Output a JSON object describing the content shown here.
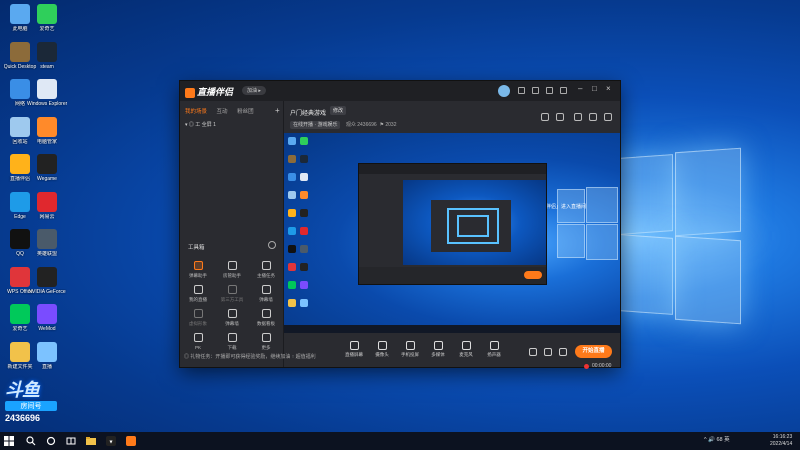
{
  "desktop": {
    "icons": [
      {
        "label": "此电脑",
        "color": "#5aa9f0"
      },
      {
        "label": "爱奇艺",
        "color": "#2fcf5b"
      },
      {
        "label": "Quick Desktop",
        "color": "#8c6b3a"
      },
      {
        "label": "steam",
        "color": "#1b2838"
      },
      {
        "label": "网络",
        "color": "#3a8ee6"
      },
      {
        "label": "Windows Explorer",
        "color": "#dfe8f5"
      },
      {
        "label": "回收站",
        "color": "#9ec9ee"
      },
      {
        "label": "电脑管家",
        "color": "#ff8a2a"
      },
      {
        "label": "直播伴侣",
        "color": "#ffb21a"
      },
      {
        "label": "Wegame",
        "color": "#222222"
      },
      {
        "label": "Edge",
        "color": "#1e9be8"
      },
      {
        "label": "网易云",
        "color": "#e0282e"
      },
      {
        "label": "QQ",
        "color": "#111111"
      },
      {
        "label": "英雄联盟",
        "color": "#4a5a6a"
      },
      {
        "label": "WPS Office",
        "color": "#e0353a"
      },
      {
        "label": "NVIDIA GeForce",
        "color": "#222222"
      },
      {
        "label": "爱奇艺",
        "color": "#00c95a"
      },
      {
        "label": "WeMod",
        "color": "#7a4cff"
      },
      {
        "label": "新建文件夹",
        "color": "#f1c24a"
      },
      {
        "label": "直播",
        "color": "#7cc2ff"
      }
    ],
    "brand": {
      "logo": "斗鱼",
      "sub": "房间号",
      "room_number": "2436696"
    }
  },
  "app": {
    "title": "直播伴侣",
    "login_pill": "加油 ▸",
    "left": {
      "tabs": [
        {
          "label": "我的场景",
          "active": true
        },
        {
          "label": "互动",
          "active": false
        },
        {
          "label": "粉丝团",
          "active": false
        }
      ],
      "add": "+",
      "scene_row": "▾  ◎   工  全屏 1",
      "tools_title": "工具箱",
      "tools": [
        {
          "label": "弹幕助手",
          "hot": true
        },
        {
          "label": "房管助手",
          "hot": false
        },
        {
          "label": "主播任务",
          "hot": false
        },
        {
          "label": "我的直播",
          "hot": false
        },
        {
          "label": "第三方工具",
          "hot": false,
          "dim": true
        },
        {
          "label": "弹幕墙",
          "hot": false
        },
        {
          "label": "虚拟形象",
          "hot": false,
          "dim": true
        },
        {
          "label": "弹幕墙",
          "hot": false
        },
        {
          "label": "数据看板",
          "hot": false
        },
        {
          "label": "PK",
          "hot": false
        },
        {
          "label": "下载",
          "hot": false
        },
        {
          "label": "更多",
          "hot": false
        }
      ]
    },
    "main": {
      "stream_title": "户门经典游戏",
      "edit_label": "修改",
      "category_tag": "在线开播 · 游戏娱乐",
      "viewers": "观众 2436696",
      "fans": "⚑ 2032",
      "overlay_text": "欢迎「直播伴侣」进入直播间",
      "controls": [
        {
          "label": "直播屏幕"
        },
        {
          "label": "摄像头"
        },
        {
          "label": "手机投屏"
        },
        {
          "label": "多媒体"
        },
        {
          "label": "麦克风"
        },
        {
          "label": "扬声器"
        }
      ],
      "live_button": "开始直播",
      "timer": "00:00:00"
    },
    "notice": "◎  礼物任务：开播即可获得经验奖励，继续加油 ↑   超值福利"
  },
  "taskbar": {
    "tray_text": "^  🔊  68  英",
    "time": "16:16:23",
    "date": "2022/4/14"
  }
}
